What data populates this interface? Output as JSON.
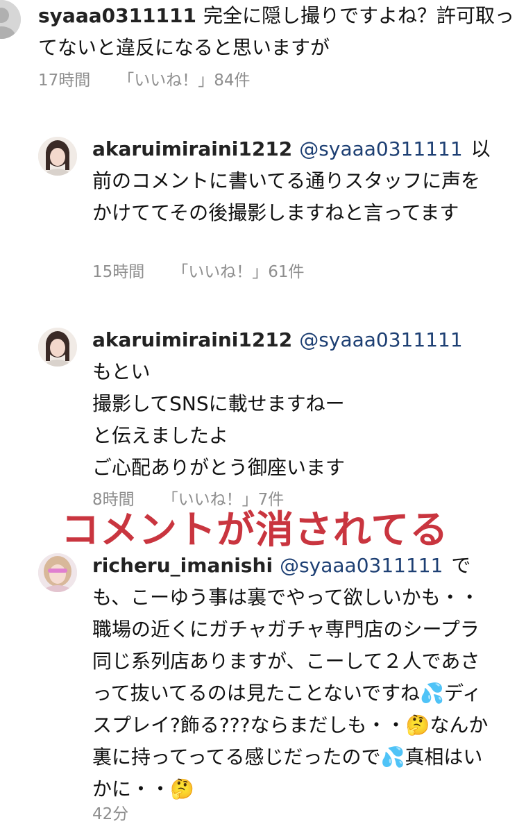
{
  "comments": [
    {
      "username": "syaaa0311111",
      "mention": "",
      "text": "完全に隠し撮りですよね？許可取ってないと違反になると思いますが",
      "time": "17時間",
      "likes": "「いいね！」84件"
    },
    {
      "username": "akaruimiraini1212",
      "mention": "@syaaa0311111",
      "text": "以前のコメントに書いてる通りスタッフに声をかけててその後撮影しますねと言ってます",
      "time": "15時間",
      "likes": "「いいね！」61件"
    },
    {
      "username": "akaruimiraini1212",
      "mention": "@syaaa0311111",
      "lines": [
        "もとい",
        "撮影してSNSに載せますねー",
        "と伝えましたよ",
        "ご心配ありがとう御座います"
      ],
      "time": "8時間",
      "likes": "「いいね！」7件"
    },
    {
      "username": "richeru_imanishi",
      "mention": "@syaaa0311111",
      "text_part1": "でも、こーゆう事は裏でやって欲しいかも・・職場の近くにガチャガチャ専門店のシープラ同じ系列店ありますが、こーして２人であさって抜いてるのは見たことないですね",
      "emoji_sweat": "💦",
      "text_part2": "ディスプレイ?飾る???ならまだしも・・",
      "emoji_think": "🤔",
      "text_part3": "なんか裏に持ってってる感じだったので",
      "text_part4": "真相はいかに・・",
      "time": "42分"
    }
  ],
  "overlay_caption": "コメントが消されてる"
}
